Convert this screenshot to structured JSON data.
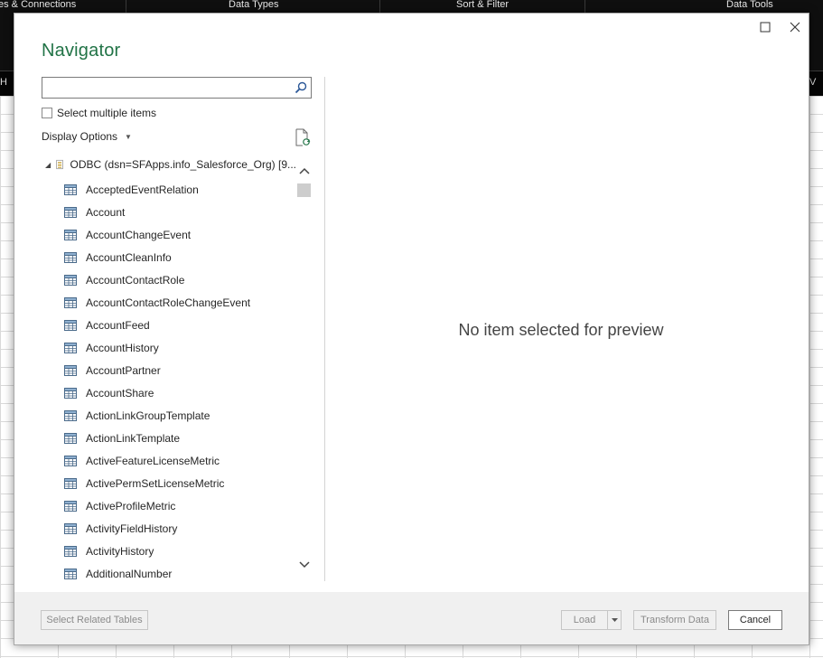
{
  "background": {
    "ribbon_fragments": [
      "es & Connections",
      "Data Types",
      "Sort & Filter",
      "Data Tools"
    ],
    "formula_bar_left": "H",
    "formula_bar_right": "V"
  },
  "dialog": {
    "title": "Navigator",
    "search": {
      "value": "",
      "placeholder": ""
    },
    "select_multiple_label": "Select multiple items",
    "display_options_label": "Display Options",
    "tree": {
      "root_label": "ODBC (dsn=SFApps.info_Salesforce_Org) [9...",
      "items": [
        "AcceptedEventRelation",
        "Account",
        "AccountChangeEvent",
        "AccountCleanInfo",
        "AccountContactRole",
        "AccountContactRoleChangeEvent",
        "AccountFeed",
        "AccountHistory",
        "AccountPartner",
        "AccountShare",
        "ActionLinkGroupTemplate",
        "ActionLinkTemplate",
        "ActiveFeatureLicenseMetric",
        "ActivePermSetLicenseMetric",
        "ActiveProfileMetric",
        "ActivityFieldHistory",
        "ActivityHistory",
        "AdditionalNumber"
      ]
    },
    "preview_message": "No item selected for preview",
    "buttons": {
      "select_related": "Select Related Tables",
      "load": "Load",
      "transform": "Transform Data",
      "cancel": "Cancel"
    }
  },
  "colors": {
    "title_green": "#217346",
    "footer_bg": "#f0f0f0"
  }
}
